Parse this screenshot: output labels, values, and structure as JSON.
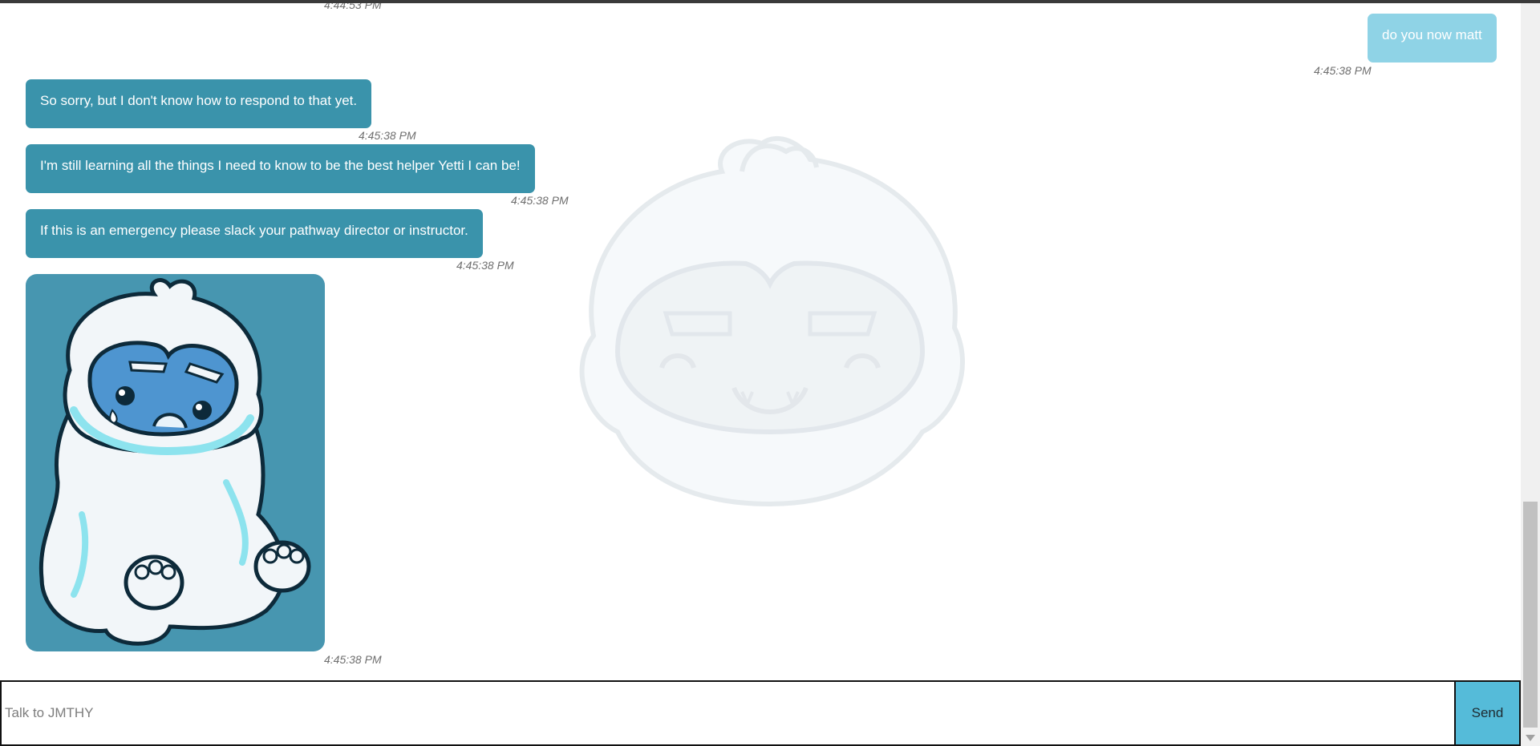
{
  "messages": {
    "prev_timestamp": "4:44:53 PM",
    "user_1": {
      "text": "do you now matt",
      "time": "4:45:38 PM"
    },
    "bot_1": {
      "text": "So sorry, but I don't know how to respond to that yet.",
      "time": "4:45:38 PM"
    },
    "bot_2": {
      "text": "I'm still learning all the things I need to know to be the best helper Yetti I can be!",
      "time": "4:45:38 PM"
    },
    "bot_3": {
      "text": "If this is an emergency please slack your pathway director or instructor.",
      "time": "4:45:38 PM"
    },
    "bot_image": {
      "icon": "sad-yeti-illustration",
      "time": "4:45:38 PM"
    }
  },
  "composer": {
    "placeholder": "Talk to JMTHY",
    "value": "",
    "send_label": "Send"
  },
  "background": {
    "icon": "yeti-watermark"
  },
  "colors": {
    "bot_bubble": "#3a93ab",
    "user_bubble": "#8fd3e6",
    "image_bubble": "#4796b0",
    "send_button": "#55bbd9"
  }
}
